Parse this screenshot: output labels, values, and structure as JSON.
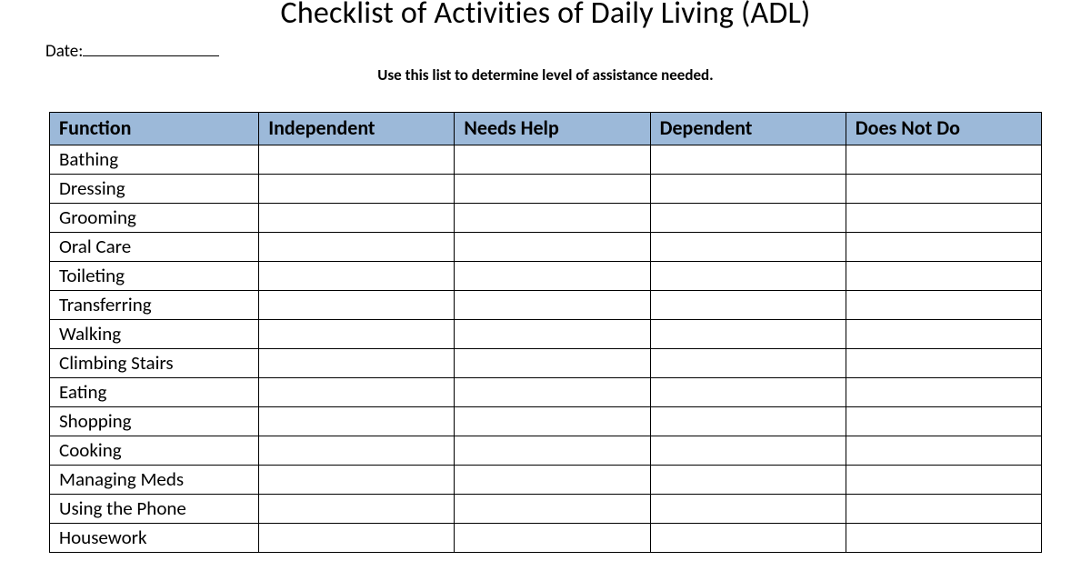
{
  "header": {
    "title": "Checklist of Activities of Daily Living (ADL)",
    "date_label": "Date:",
    "subtitle": "Use this list to determine level of assistance needed."
  },
  "table": {
    "columns": [
      "Function",
      "Independent",
      "Needs Help",
      "Dependent",
      "Does Not Do"
    ],
    "rows": [
      "Bathing",
      "Dressing",
      "Grooming",
      "Oral Care",
      "Toileting",
      "Transferring",
      "Walking",
      "Climbing Stairs",
      "Eating",
      "Shopping",
      "Cooking",
      "Managing Meds",
      "Using the Phone",
      "Housework"
    ]
  }
}
